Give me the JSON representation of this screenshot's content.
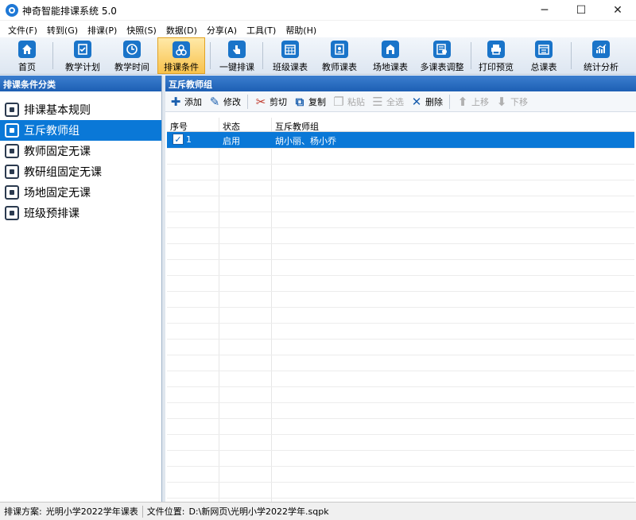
{
  "window": {
    "title": "神奇智能排课系统 5.0",
    "controls": {
      "minimize": "─",
      "maximize": "☐",
      "close": "✕"
    }
  },
  "menu": [
    "文件(F)",
    "转到(G)",
    "排课(P)",
    "快照(S)",
    "数据(D)",
    "分享(A)",
    "工具(T)",
    "帮助(H)"
  ],
  "toolbar": [
    {
      "label": "首页",
      "icon": "home-icon",
      "active": false
    },
    {
      "label": "教学计划",
      "icon": "clipboard-check-icon",
      "active": false
    },
    {
      "label": "教学时间",
      "icon": "clock-icon",
      "active": false
    },
    {
      "label": "排课条件",
      "icon": "circles-icon",
      "active": true
    },
    {
      "label": "一键排课",
      "icon": "hand-click-icon",
      "active": false
    },
    {
      "label": "班级课表",
      "icon": "calendar-grid-icon",
      "active": false
    },
    {
      "label": "教师课表",
      "icon": "teacher-card-icon",
      "active": false
    },
    {
      "label": "场地课表",
      "icon": "building-icon",
      "active": false
    },
    {
      "label": "多课表调整",
      "icon": "adjust-table-icon",
      "active": false
    },
    {
      "label": "打印预览",
      "icon": "printer-icon",
      "active": false
    },
    {
      "label": "总课表",
      "icon": "summary-table-icon",
      "active": false
    },
    {
      "label": "统计分析",
      "icon": "chart-icon",
      "active": false
    }
  ],
  "left_panel": {
    "title": "排课条件分类",
    "items": [
      {
        "label": "排课基本规则",
        "icon": "rules-icon",
        "selected": false
      },
      {
        "label": "互斥教师组",
        "icon": "teacher-group-icon",
        "selected": true
      },
      {
        "label": "教师固定无课",
        "icon": "teacher-icon",
        "selected": false
      },
      {
        "label": "教研组固定无课",
        "icon": "cube-icon",
        "selected": false
      },
      {
        "label": "场地固定无课",
        "icon": "room-icon",
        "selected": false
      },
      {
        "label": "班级预排课",
        "icon": "book-icon",
        "selected": false
      }
    ]
  },
  "right_panel": {
    "title": "互斥教师组",
    "actions": [
      {
        "label": "添加",
        "glyph": "✚",
        "color": "#1a5fae",
        "enabled": true
      },
      {
        "label": "修改",
        "glyph": "✎",
        "color": "#1a5fae",
        "enabled": true
      },
      {
        "label": "剪切",
        "glyph": "✂",
        "color": "#c0392b",
        "enabled": true
      },
      {
        "label": "复制",
        "glyph": "⧉",
        "color": "#1a5fae",
        "enabled": true
      },
      {
        "label": "粘贴",
        "glyph": "❐",
        "color": "#a8a8a8",
        "enabled": false
      },
      {
        "label": "全选",
        "glyph": "☰",
        "color": "#a8a8a8",
        "enabled": false
      },
      {
        "label": "删除",
        "glyph": "✕",
        "color": "#1a5fae",
        "enabled": true
      },
      {
        "label": "上移",
        "glyph": "⬆",
        "color": "#a8a8a8",
        "enabled": false
      },
      {
        "label": "下移",
        "glyph": "⬇",
        "color": "#a8a8a8",
        "enabled": false
      }
    ],
    "table": {
      "columns": [
        "序号",
        "状态",
        "互斥教师组"
      ],
      "rows": [
        {
          "index": "1",
          "status": "启用",
          "teachers": "胡小丽、杨小乔",
          "checked": true,
          "selected": true
        }
      ]
    }
  },
  "statusbar": {
    "scheme_label": "排课方案:",
    "scheme_value": "光明小学2022学年课表",
    "file_label": "文件位置:",
    "file_value": "D:\\新网页\\光明小学2022学年.sqpk"
  },
  "colors": {
    "selection": "#0a78d7",
    "header_gradient_top": "#3c7fcf",
    "header_gradient_bottom": "#1d5fb4",
    "active_toolbar": "#f8c24c"
  }
}
